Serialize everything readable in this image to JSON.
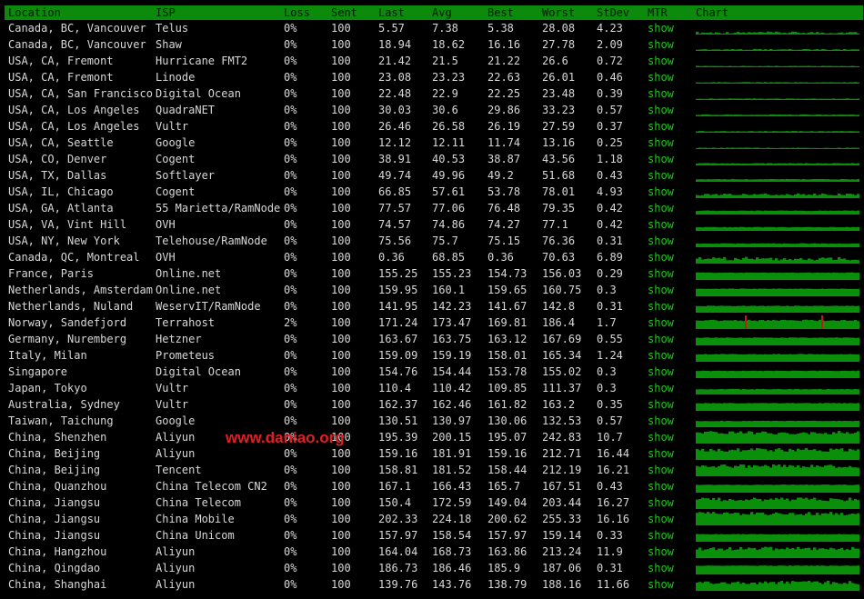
{
  "header": {
    "location": "Location",
    "isp": "ISP",
    "loss": "Loss",
    "sent": "Sent",
    "last": "Last",
    "avg": "Avg",
    "best": "Best",
    "worst": "Worst",
    "stdev": "StDev",
    "mtr": "MTR",
    "chart": "Chart"
  },
  "mtr_label": "show",
  "watermark": "www.daniao.org",
  "colors": {
    "header_bg": "#0b8a0b",
    "link": "#21c321",
    "chart_bar": "#0a8f0a",
    "chart_loss": "#c21a1a",
    "watermark": "#e21f26"
  },
  "rows": [
    {
      "location": "Canada, BC, Vancouver",
      "isp": "Telus",
      "loss": "0%",
      "sent": "100",
      "last": "5.57",
      "avg": "7.38",
      "best": "5.38",
      "worst": "28.08",
      "stdev": "4.23"
    },
    {
      "location": "Canada, BC, Vancouver",
      "isp": "Shaw",
      "loss": "0%",
      "sent": "100",
      "last": "18.94",
      "avg": "18.62",
      "best": "16.16",
      "worst": "27.78",
      "stdev": "2.09"
    },
    {
      "location": "USA, CA, Fremont",
      "isp": "Hurricane FMT2",
      "loss": "0%",
      "sent": "100",
      "last": "21.42",
      "avg": "21.5",
      "best": "21.22",
      "worst": "26.6",
      "stdev": "0.72"
    },
    {
      "location": "USA, CA, Fremont",
      "isp": "Linode",
      "loss": "0%",
      "sent": "100",
      "last": "23.08",
      "avg": "23.23",
      "best": "22.63",
      "worst": "26.01",
      "stdev": "0.46"
    },
    {
      "location": "USA, CA, San Francisco",
      "isp": "Digital Ocean",
      "loss": "0%",
      "sent": "100",
      "last": "22.48",
      "avg": "22.9",
      "best": "22.25",
      "worst": "23.48",
      "stdev": "0.39"
    },
    {
      "location": "USA, CA, Los Angeles",
      "isp": "QuadraNET",
      "loss": "0%",
      "sent": "100",
      "last": "30.03",
      "avg": "30.6",
      "best": "29.86",
      "worst": "33.23",
      "stdev": "0.57"
    },
    {
      "location": "USA, CA, Los Angeles",
      "isp": "Vultr",
      "loss": "0%",
      "sent": "100",
      "last": "26.46",
      "avg": "26.58",
      "best": "26.19",
      "worst": "27.59",
      "stdev": "0.37"
    },
    {
      "location": "USA, CA, Seattle",
      "isp": "Google",
      "loss": "0%",
      "sent": "100",
      "last": "12.12",
      "avg": "12.11",
      "best": "11.74",
      "worst": "13.16",
      "stdev": "0.25"
    },
    {
      "location": "USA, CO, Denver",
      "isp": "Cogent",
      "loss": "0%",
      "sent": "100",
      "last": "38.91",
      "avg": "40.53",
      "best": "38.87",
      "worst": "43.56",
      "stdev": "1.18"
    },
    {
      "location": "USA, TX, Dallas",
      "isp": "Softlayer",
      "loss": "0%",
      "sent": "100",
      "last": "49.74",
      "avg": "49.96",
      "best": "49.2",
      "worst": "51.68",
      "stdev": "0.43"
    },
    {
      "location": "USA, IL, Chicago",
      "isp": "Cogent",
      "loss": "0%",
      "sent": "100",
      "last": "66.85",
      "avg": "57.61",
      "best": "53.78",
      "worst": "78.01",
      "stdev": "4.93"
    },
    {
      "location": "USA, GA, Atlanta",
      "isp": "55 Marietta/RamNode",
      "loss": "0%",
      "sent": "100",
      "last": "77.57",
      "avg": "77.06",
      "best": "76.48",
      "worst": "79.35",
      "stdev": "0.42"
    },
    {
      "location": "USA, VA, Vint Hill",
      "isp": "OVH",
      "loss": "0%",
      "sent": "100",
      "last": "74.57",
      "avg": "74.86",
      "best": "74.27",
      "worst": "77.1",
      "stdev": "0.42"
    },
    {
      "location": "USA, NY, New York",
      "isp": "Telehouse/RamNode",
      "loss": "0%",
      "sent": "100",
      "last": "75.56",
      "avg": "75.7",
      "best": "75.15",
      "worst": "76.36",
      "stdev": "0.31"
    },
    {
      "location": "Canada, QC, Montreal",
      "isp": "OVH",
      "loss": "0%",
      "sent": "100",
      "last": "0.36",
      "avg": "68.85",
      "best": "0.36",
      "worst": "70.63",
      "stdev": "6.89"
    },
    {
      "location": "France, Paris",
      "isp": "Online.net",
      "loss": "0%",
      "sent": "100",
      "last": "155.25",
      "avg": "155.23",
      "best": "154.73",
      "worst": "156.03",
      "stdev": "0.29"
    },
    {
      "location": "Netherlands, Amsterdam",
      "isp": "Online.net",
      "loss": "0%",
      "sent": "100",
      "last": "159.95",
      "avg": "160.1",
      "best": "159.65",
      "worst": "160.75",
      "stdev": "0.3"
    },
    {
      "location": "Netherlands, Nuland",
      "isp": "WeservIT/RamNode",
      "loss": "0%",
      "sent": "100",
      "last": "141.95",
      "avg": "142.23",
      "best": "141.67",
      "worst": "142.8",
      "stdev": "0.31"
    },
    {
      "location": "Norway, Sandefjord",
      "isp": "Terrahost",
      "loss": "2%",
      "sent": "100",
      "last": "171.24",
      "avg": "173.47",
      "best": "169.81",
      "worst": "186.4",
      "stdev": "1.7"
    },
    {
      "location": "Germany, Nuremberg",
      "isp": "Hetzner",
      "loss": "0%",
      "sent": "100",
      "last": "163.67",
      "avg": "163.75",
      "best": "163.12",
      "worst": "167.69",
      "stdev": "0.55"
    },
    {
      "location": "Italy, Milan",
      "isp": "Prometeus",
      "loss": "0%",
      "sent": "100",
      "last": "159.09",
      "avg": "159.19",
      "best": "158.01",
      "worst": "165.34",
      "stdev": "1.24"
    },
    {
      "location": "Singapore",
      "isp": "Digital Ocean",
      "loss": "0%",
      "sent": "100",
      "last": "154.76",
      "avg": "154.44",
      "best": "153.78",
      "worst": "155.02",
      "stdev": "0.3"
    },
    {
      "location": "Japan, Tokyo",
      "isp": "Vultr",
      "loss": "0%",
      "sent": "100",
      "last": "110.4",
      "avg": "110.42",
      "best": "109.85",
      "worst": "111.37",
      "stdev": "0.3"
    },
    {
      "location": "Australia, Sydney",
      "isp": "Vultr",
      "loss": "0%",
      "sent": "100",
      "last": "162.37",
      "avg": "162.46",
      "best": "161.82",
      "worst": "163.2",
      "stdev": "0.35"
    },
    {
      "location": "Taiwan, Taichung",
      "isp": "Google",
      "loss": "0%",
      "sent": "100",
      "last": "130.51",
      "avg": "130.97",
      "best": "130.06",
      "worst": "132.53",
      "stdev": "0.57"
    },
    {
      "location": "China, Shenzhen",
      "isp": "Aliyun",
      "loss": "0%",
      "sent": "100",
      "last": "195.39",
      "avg": "200.15",
      "best": "195.07",
      "worst": "242.83",
      "stdev": "10.7"
    },
    {
      "location": "China, Beijing",
      "isp": "Aliyun",
      "loss": "0%",
      "sent": "100",
      "last": "159.16",
      "avg": "181.91",
      "best": "159.16",
      "worst": "212.71",
      "stdev": "16.44"
    },
    {
      "location": "China, Beijing",
      "isp": "Tencent",
      "loss": "0%",
      "sent": "100",
      "last": "158.81",
      "avg": "181.52",
      "best": "158.44",
      "worst": "212.19",
      "stdev": "16.21"
    },
    {
      "location": "China, Quanzhou",
      "isp": "China Telecom CN2",
      "loss": "0%",
      "sent": "100",
      "last": "167.1",
      "avg": "166.43",
      "best": "165.7",
      "worst": "167.51",
      "stdev": "0.43"
    },
    {
      "location": "China, Jiangsu",
      "isp": "China Telecom",
      "loss": "0%",
      "sent": "100",
      "last": "150.4",
      "avg": "172.59",
      "best": "149.04",
      "worst": "203.44",
      "stdev": "16.27"
    },
    {
      "location": "China, Jiangsu",
      "isp": "China Mobile",
      "loss": "0%",
      "sent": "100",
      "last": "202.33",
      "avg": "224.18",
      "best": "200.62",
      "worst": "255.33",
      "stdev": "16.16"
    },
    {
      "location": "China, Jiangsu",
      "isp": "China Unicom",
      "loss": "0%",
      "sent": "100",
      "last": "157.97",
      "avg": "158.54",
      "best": "157.97",
      "worst": "159.14",
      "stdev": "0.33"
    },
    {
      "location": "China, Hangzhou",
      "isp": "Aliyun",
      "loss": "0%",
      "sent": "100",
      "last": "164.04",
      "avg": "168.73",
      "best": "163.86",
      "worst": "213.24",
      "stdev": "11.9"
    },
    {
      "location": "China, Qingdao",
      "isp": "Aliyun",
      "loss": "0%",
      "sent": "100",
      "last": "186.73",
      "avg": "186.46",
      "best": "185.9",
      "worst": "187.06",
      "stdev": "0.31"
    },
    {
      "location": "China, Shanghai",
      "isp": "Aliyun",
      "loss": "0%",
      "sent": "100",
      "last": "139.76",
      "avg": "143.76",
      "best": "138.79",
      "worst": "188.16",
      "stdev": "11.66"
    }
  ]
}
